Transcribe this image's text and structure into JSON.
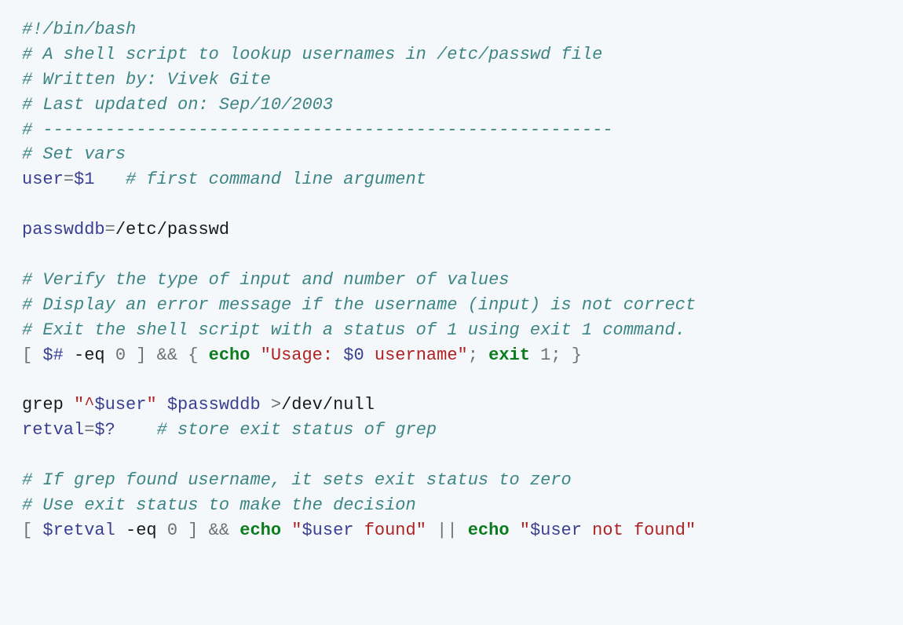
{
  "code": {
    "l1": {
      "comment": "#!/bin/bash"
    },
    "l2": {
      "comment": "# A shell script to lookup usernames in /etc/passwd file"
    },
    "l3": {
      "comment": "# Written by: Vivek Gite"
    },
    "l4": {
      "comment": "# Last updated on: Sep/10/2003"
    },
    "l5": {
      "comment": "# -------------------------------------------------------"
    },
    "l6": {
      "comment": "# Set vars"
    },
    "l7": {
      "var": "user",
      "eq": "=",
      "val": "$1",
      "sp": "   ",
      "comment": "# first command line argument"
    },
    "l8": {
      "var": "passwddb",
      "eq": "=",
      "val": "/etc/passwd"
    },
    "l9": {
      "comment": "# Verify the type of input and number of values"
    },
    "l10": {
      "comment": "# Display an error message if the username (input) is not correct"
    },
    "l11": {
      "comment": "# Exit the shell script with a status of 1 using exit 1 command."
    },
    "l12": {
      "lb": "[ ",
      "var1": "$#",
      "sp1": " ",
      "opt": "-eq",
      "sp2": " ",
      "n0": "0",
      "rb": " ]",
      "and": " && ",
      "ob": "{ ",
      "echo": "echo",
      "sp3": " ",
      "q1": "\"Usage: ",
      "v0": "$0",
      "q2": " username\"",
      "sc1": "; ",
      "exit": "exit",
      "sp4": " ",
      "n1": "1",
      "sc2": "; ",
      "cb": "}"
    },
    "l13": {
      "grep": "grep",
      "sp1": " ",
      "q1": "\"^",
      "v": "$user",
      "q2": "\"",
      "sp2": " ",
      "db": "$passwddb",
      "sp3": " ",
      "gt": ">",
      "dn": "/dev/null"
    },
    "l14": {
      "var": "retval",
      "eq": "=",
      "val": "$?",
      "sp": "    ",
      "comment": "# store exit status of grep"
    },
    "l15": {
      "comment": "# If grep found username, it sets exit status to zero"
    },
    "l16": {
      "comment": "# Use exit status to make the decision"
    },
    "l17": {
      "lb": "[ ",
      "rv": "$retval",
      "sp1": " ",
      "opt": "-eq",
      "sp2": " ",
      "n0": "0",
      "rb": " ]",
      "and": " && ",
      "echo1": "echo",
      "sp3": " ",
      "q1": "\"",
      "u1": "$user",
      "q2": " found\"",
      "or": " || ",
      "echo2": "echo",
      "sp4": " ",
      "q3": "\"",
      "u2": "$user",
      "q4": " not found\""
    }
  }
}
